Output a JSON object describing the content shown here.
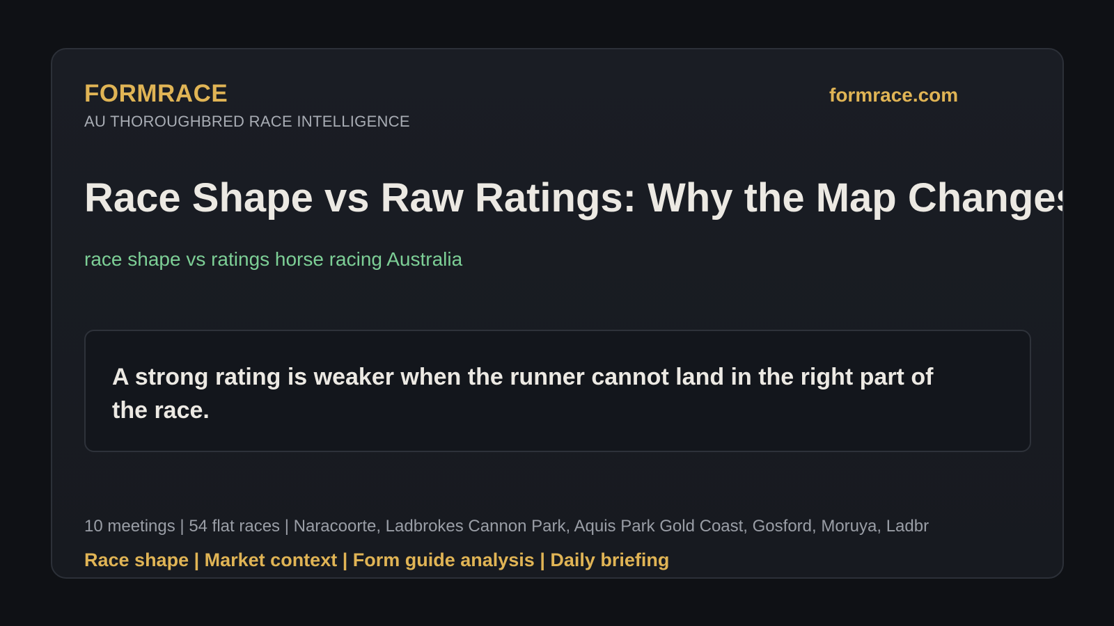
{
  "brand": {
    "name": "FORMRACE",
    "tagline": "AU THOROUGHBRED RACE INTELLIGENCE",
    "site": "formrace.com"
  },
  "article": {
    "headline": "Race Shape vs Raw Ratings: Why the Map Changes th",
    "keyword": "race shape vs ratings horse racing Australia",
    "pull_quote": "A strong rating is weaker when the runner cannot land in the right part of the race."
  },
  "footer": {
    "meta": "10 meetings | 54 flat races | Naracoorte, Ladbrokes Cannon Park, Aquis Park Gold Coast, Gosford, Moruya, Ladbr",
    "topics": "Race shape | Market context | Form guide analysis | Daily briefing"
  },
  "colors": {
    "background": "#0f1115",
    "card": "#1a1d24",
    "accent_gold": "#e0b455",
    "accent_green": "#7dcf96",
    "text_primary": "#ece9e3",
    "text_muted": "#9a9ea6"
  }
}
